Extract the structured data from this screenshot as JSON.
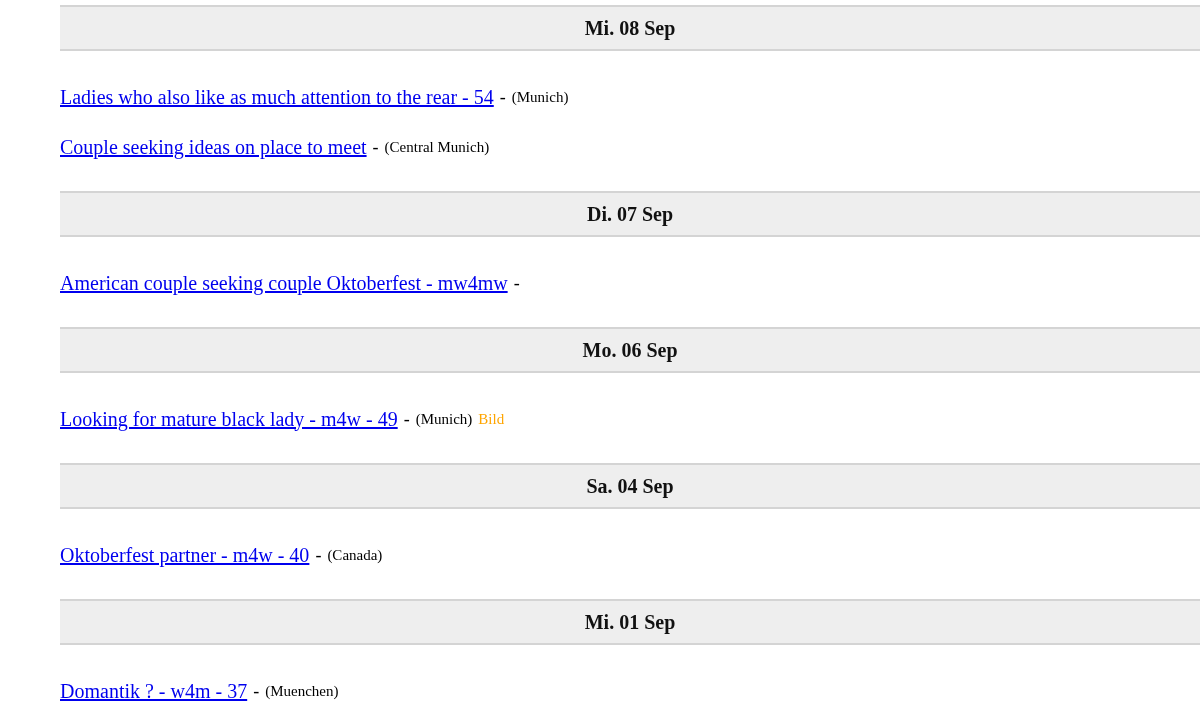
{
  "days": [
    {
      "date": "Mi. 08 Sep",
      "posts": [
        {
          "title": "Ladies who also like as much attention to the rear - 54",
          "separator": "-",
          "location": "(Munich)"
        },
        {
          "title": "Couple seeking ideas on place to meet",
          "separator": "-",
          "location": "(Central Munich)"
        }
      ]
    },
    {
      "date": "Di. 07 Sep",
      "posts": [
        {
          "title": "American couple seeking couple Oktoberfest - mw4mw",
          "separator": "-"
        }
      ]
    },
    {
      "date": "Mo. 06 Sep",
      "posts": [
        {
          "title": "Looking for mature black lady - m4w - 49",
          "separator": "-",
          "location": "(Munich)",
          "picture_label": "Bild"
        }
      ]
    },
    {
      "date": "Sa. 04 Sep",
      "posts": [
        {
          "title": "Oktoberfest partner - m4w - 40",
          "separator": "-",
          "location": "(Canada)"
        }
      ]
    },
    {
      "date": "Mi. 01 Sep",
      "posts": [
        {
          "title": "Domantik ? - w4m - 37",
          "separator": "-",
          "location": "(Muenchen)"
        }
      ]
    }
  ]
}
